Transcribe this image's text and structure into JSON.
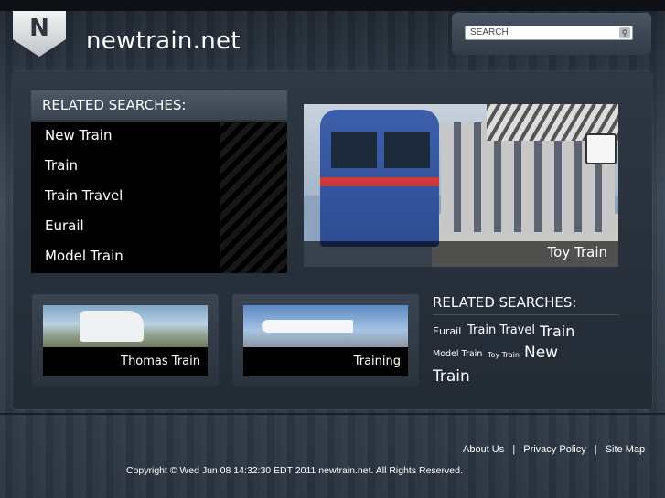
{
  "header": {
    "logo_letter": "N",
    "site_title": "newtrain.net",
    "search": {
      "placeholder": "SEARCH"
    }
  },
  "related_left": {
    "title": "RELATED SEARCHES:",
    "items": [
      "New Train",
      "Train",
      "Train Travel",
      "Eurail",
      "Model Train"
    ]
  },
  "hero": {
    "caption": "Toy Train"
  },
  "thumbs": [
    {
      "caption": "Thomas Train",
      "icon": "bus-photo"
    },
    {
      "caption": "Training",
      "icon": "airplane-photo"
    }
  ],
  "related_right": {
    "title": "RELATED SEARCHES:",
    "cloud": [
      "Eurail",
      "Train Travel",
      "Train",
      "Model Train",
      "Toy Train",
      "New",
      "Train"
    ]
  },
  "footer": {
    "links": [
      "About Us",
      "Privacy Policy",
      "Site Map"
    ],
    "separator": "|",
    "copyright": "Copyright © Wed Jun 08 14:32:30 EDT 2011 newtrain.net. All Rights Reserved."
  },
  "colors": {
    "background": "#2b3440",
    "panel": "#2e3844",
    "list_bg": "#000000",
    "accent_red": "#d0393a"
  }
}
